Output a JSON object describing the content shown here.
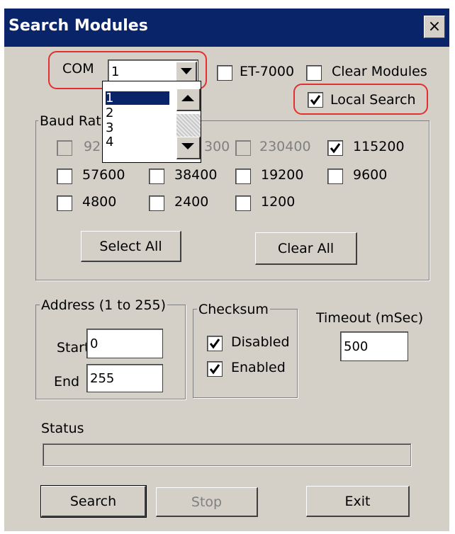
{
  "window": {
    "title": "Search Modules",
    "close_glyph": "×"
  },
  "com": {
    "label": "COM",
    "value": "1",
    "options": [
      "1",
      "2",
      "3",
      "4"
    ]
  },
  "top_checks": {
    "et7000": {
      "label": "ET-7000",
      "checked": false
    },
    "clear_modules": {
      "label": "Clear Modules",
      "checked": false
    },
    "local_search": {
      "label": "Local Search",
      "checked": true
    }
  },
  "baud": {
    "legend": "Baud Rat",
    "row1": [
      {
        "label": "921",
        "checked": false,
        "disabled": true
      },
      {
        "label": "300",
        "checked": false,
        "disabled": true
      },
      {
        "label": "230400",
        "checked": false,
        "disabled": true
      },
      {
        "label": "115200",
        "checked": true,
        "disabled": false
      }
    ],
    "row2": [
      {
        "label": "57600",
        "checked": false
      },
      {
        "label": "38400",
        "checked": false
      },
      {
        "label": "19200",
        "checked": false
      },
      {
        "label": "9600",
        "checked": false
      }
    ],
    "row3": [
      {
        "label": "4800",
        "checked": false
      },
      {
        "label": "2400",
        "checked": false
      },
      {
        "label": "1200",
        "checked": false
      }
    ],
    "select_all": "Select All",
    "clear_all": "Clear All"
  },
  "address": {
    "legend": "Address (1 to 255)",
    "start_label": "Start",
    "start_value": "0",
    "end_label": "End",
    "end_value": "255"
  },
  "checksum": {
    "legend": "Checksum",
    "disabled_label": "Disabled",
    "disabled_checked": true,
    "enabled_label": "Enabled",
    "enabled_checked": true
  },
  "timeout": {
    "label": "Timeout (mSec)",
    "value": "500"
  },
  "status": {
    "label": "Status",
    "progress": 0
  },
  "buttons": {
    "search": "Search",
    "stop": "Stop",
    "exit": "Exit"
  },
  "colors": {
    "titlebar": "#0a246a",
    "face": "#d4d0c8",
    "highlight_ring": "#e03030"
  }
}
